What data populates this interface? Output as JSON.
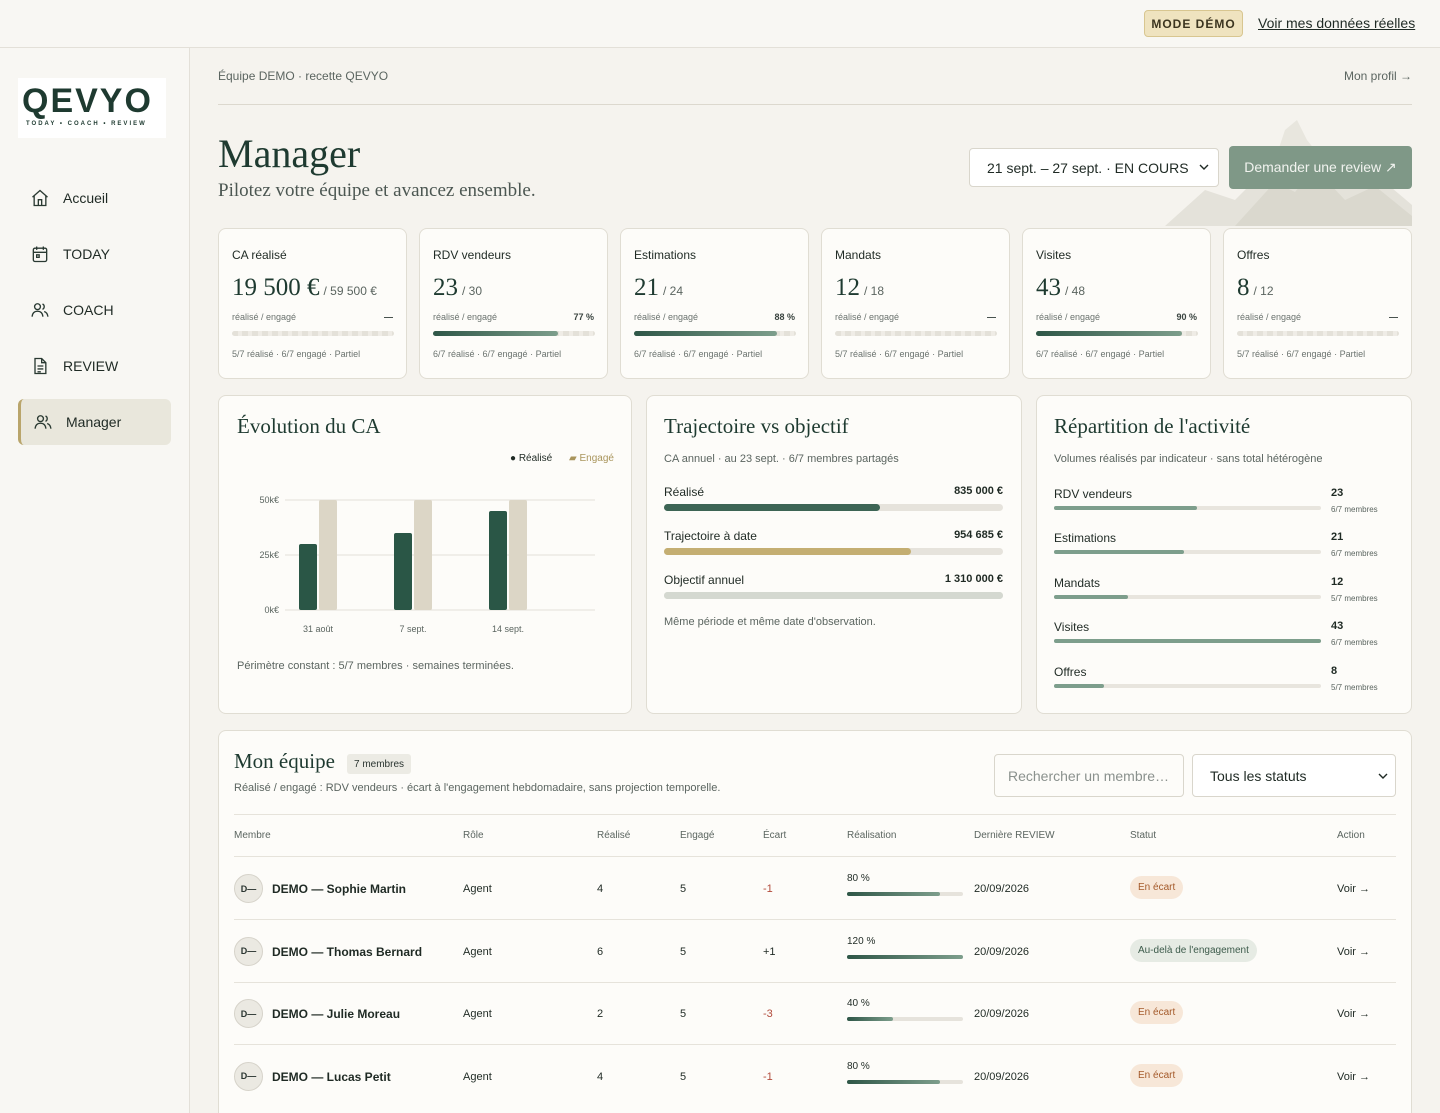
{
  "topbar": {
    "demo_badge": "MODE DÉMO",
    "real_data_link": "Voir mes données réelles"
  },
  "logo": {
    "word": "QEVYO",
    "tagline": "TODAY • COACH • REVIEW"
  },
  "sidebar": {
    "items": [
      {
        "label": "Accueil",
        "icon": "home-icon"
      },
      {
        "label": "TODAY",
        "icon": "calendar-icon"
      },
      {
        "label": "COACH",
        "icon": "users-icon"
      },
      {
        "label": "REVIEW",
        "icon": "document-icon"
      },
      {
        "label": "Manager",
        "icon": "users-icon",
        "active": true
      }
    ]
  },
  "header": {
    "breadcrumb": "Équipe DEMO · recette QEVYO",
    "profile_link": "Mon profil →",
    "title": "Manager",
    "subtitle": "Pilotez votre équipe et avancez ensemble.",
    "week_select": "21 sept. – 27 sept. · EN COURS",
    "review_button": "Demander une review ↗"
  },
  "kpis": [
    {
      "label": "CA réalisé",
      "value": "19 500 €",
      "total": "/ 59 500 €",
      "sub": "réalisé / engagé",
      "pct": "—",
      "fill": 0,
      "foot": "5/7 réalisé · 6/7 engagé · Partiel"
    },
    {
      "label": "RDV vendeurs",
      "value": "23",
      "total": "/ 30",
      "sub": "réalisé / engagé",
      "pct": "77 %",
      "fill": 0.77,
      "foot": "6/7 réalisé · 6/7 engagé · Partiel"
    },
    {
      "label": "Estimations",
      "value": "21",
      "total": "/ 24",
      "sub": "réalisé / engagé",
      "pct": "88 %",
      "fill": 0.88,
      "foot": "6/7 réalisé · 6/7 engagé · Partiel"
    },
    {
      "label": "Mandats",
      "value": "12",
      "total": "/ 18",
      "sub": "réalisé / engagé",
      "pct": "—",
      "fill": 0,
      "foot": "5/7 réalisé · 6/7 engagé · Partiel"
    },
    {
      "label": "Visites",
      "value": "43",
      "total": "/ 48",
      "sub": "réalisé / engagé",
      "pct": "90 %",
      "fill": 0.9,
      "foot": "6/7 réalisé · 6/7 engagé · Partiel"
    },
    {
      "label": "Offres",
      "value": "8",
      "total": "/ 12",
      "sub": "réalisé / engagé",
      "pct": "—",
      "fill": 0,
      "foot": "5/7 réalisé · 6/7 engagé · Partiel"
    }
  ],
  "evolution": {
    "title": "Évolution du CA",
    "legend_realise": "● Réalisé",
    "legend_engage": "▰ Engagé",
    "note": "Périmètre constant : 5/7 membres · semaines terminées."
  },
  "chart_data": {
    "type": "bar",
    "categories": [
      "31 août",
      "7 sept.",
      "14 sept."
    ],
    "series": [
      {
        "name": "Réalisé",
        "values": [
          30000,
          35000,
          45000
        ],
        "color": "#2a5646"
      },
      {
        "name": "Engagé",
        "values": [
          50000,
          50000,
          50000
        ],
        "color": "#dcd6c6"
      }
    ],
    "yticks": [
      "0k€",
      "25k€",
      "50k€"
    ],
    "ylim": [
      0,
      50000
    ],
    "legend": "top-right",
    "grid": true
  },
  "trajectoire": {
    "title": "Trajectoire vs objectif",
    "sub": "CA annuel · au 23 sept. · 6/7 membres partagés",
    "rows": [
      {
        "label": "Réalisé",
        "value": "835 000 €",
        "fill": 0.637,
        "color": "#3d6555"
      },
      {
        "label": "Trajectoire à date",
        "value": "954 685 €",
        "fill": 0.729,
        "color": "#c4ae72"
      },
      {
        "label": "Objectif annuel",
        "value": "1 310 000 €",
        "fill": 1.0,
        "color": "#d4d8d0"
      }
    ],
    "note": "Même période et même date d'observation."
  },
  "repartition": {
    "title": "Répartition de l'activité",
    "sub": "Volumes réalisés par indicateur · sans total hétérogène",
    "rows": [
      {
        "label": "RDV vendeurs",
        "value": "23",
        "members": "6/7 membres",
        "fill": 0.535
      },
      {
        "label": "Estimations",
        "value": "21",
        "members": "6/7 membres",
        "fill": 0.488
      },
      {
        "label": "Mandats",
        "value": "12",
        "members": "5/7 membres",
        "fill": 0.279
      },
      {
        "label": "Visites",
        "value": "43",
        "members": "6/7 membres",
        "fill": 1.0
      },
      {
        "label": "Offres",
        "value": "8",
        "members": "5/7 membres",
        "fill": 0.186
      }
    ]
  },
  "team": {
    "title": "Mon équipe",
    "count": "7 membres",
    "sub": "Réalisé / engagé : RDV vendeurs · écart à l'engagement hebdomadaire, sans projection temporelle.",
    "search_placeholder": "Rechercher un membre…",
    "status_filter": "Tous les statuts",
    "columns": [
      "Membre",
      "Rôle",
      "Réalisé",
      "Engagé",
      "Écart",
      "Réalisation",
      "Dernière REVIEW",
      "Statut",
      "Action"
    ],
    "rows": [
      {
        "initials": "D—",
        "name": "DEMO — Sophie Martin",
        "role": "Agent",
        "realise": "4",
        "engage": "5",
        "ecart": "-1",
        "neg": true,
        "pct": "80 %",
        "fill": 0.8,
        "review": "20/09/2026",
        "status": "En écart",
        "kind": "ecart",
        "action": "Voir →"
      },
      {
        "initials": "D—",
        "name": "DEMO — Thomas Bernard",
        "role": "Agent",
        "realise": "6",
        "engage": "5",
        "ecart": "+1",
        "neg": false,
        "pct": "120 %",
        "fill": 1.0,
        "review": "20/09/2026",
        "status": "Au-delà de l'engagement",
        "kind": "ok",
        "action": "Voir →"
      },
      {
        "initials": "D—",
        "name": "DEMO — Julie Moreau",
        "role": "Agent",
        "realise": "2",
        "engage": "5",
        "ecart": "-3",
        "neg": true,
        "pct": "40 %",
        "fill": 0.4,
        "review": "20/09/2026",
        "status": "En écart",
        "kind": "ecart",
        "action": "Voir →"
      },
      {
        "initials": "D—",
        "name": "DEMO — Lucas Petit",
        "role": "Agent",
        "realise": "4",
        "engage": "5",
        "ecart": "-1",
        "neg": true,
        "pct": "80 %",
        "fill": 0.8,
        "review": "20/09/2026",
        "status": "En écart",
        "kind": "ecart",
        "action": "Voir →"
      }
    ]
  }
}
